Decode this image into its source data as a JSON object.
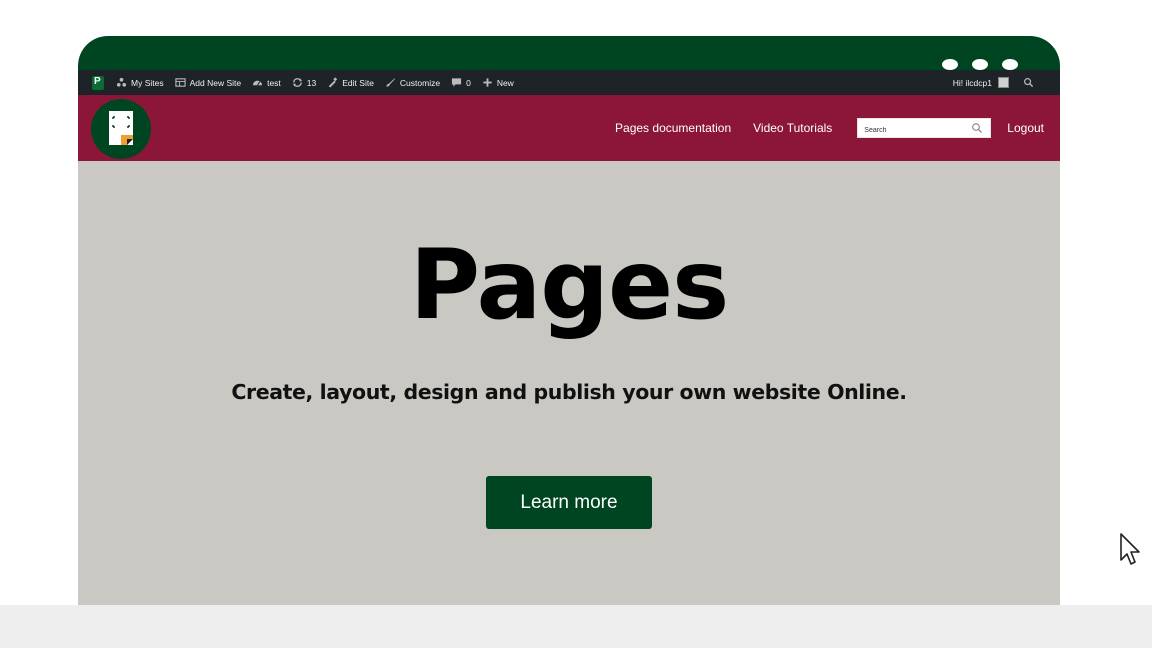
{
  "admin_bar": {
    "my_sites": "My Sites",
    "add_new_site": "Add New Site",
    "site_name": "test",
    "updates_count": "13",
    "edit_site": "Edit Site",
    "customize": "Customize",
    "comments_count": "0",
    "new": "New",
    "greeting": "Hi! ilcdcp1"
  },
  "header": {
    "nav": [
      "Pages documentation",
      "Video Tutorials"
    ],
    "search_placeholder": "Search",
    "logout": "Logout"
  },
  "hero": {
    "title": "Pages",
    "subtitle": "Create, layout, design and publish your own website Online.",
    "cta": "Learn more"
  },
  "colors": {
    "frame_green": "#004522",
    "admin_bar": "#1d2327",
    "header_maroon": "#8c1638",
    "hero_bg": "#cac8c2",
    "cta_bg": "#004522"
  },
  "icons": [
    "wp-logo-icon",
    "my-sites-icon",
    "add-site-icon",
    "dashboard-icon",
    "updates-icon",
    "edit-site-icon",
    "customize-icon",
    "comment-icon",
    "plus-icon",
    "avatar-icon",
    "admin-search-icon",
    "site-logo-icon",
    "search-icon",
    "mouse-cursor-icon"
  ]
}
